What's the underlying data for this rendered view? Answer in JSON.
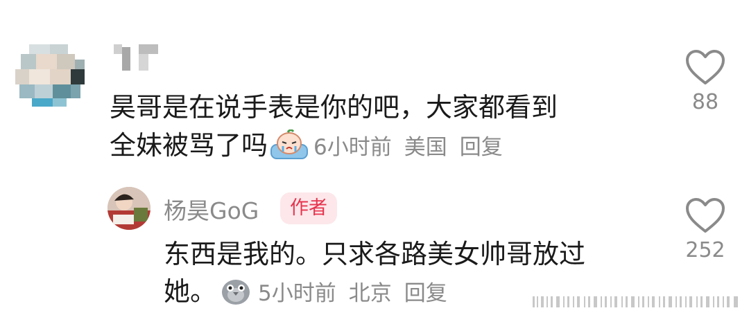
{
  "comment": {
    "text_line1": "昊哥是在说手表是你的吧，大家都看到",
    "text_line2": "全妹被骂了吗",
    "time": "6小时前",
    "location": "美国",
    "reply_label": "回复",
    "likes": "88"
  },
  "reply": {
    "author": "杨昊GoG",
    "badge": "作者",
    "text_line1": "东西是我的。只求各路美女帅哥放过",
    "text_line2": "她。",
    "time": "5小时前",
    "location": "北京",
    "reply_label": "回复",
    "likes": "252"
  },
  "icons": {
    "like": "heart-outline-icon",
    "comment_emoji": "crying-emoji-icon",
    "reply_emoji": "pigeon-emoji-icon"
  },
  "colors": {
    "text": "#1a1a1a",
    "meta": "#8a8a8a",
    "badge_bg": "#fde7ea",
    "badge_text": "#e5354e"
  }
}
